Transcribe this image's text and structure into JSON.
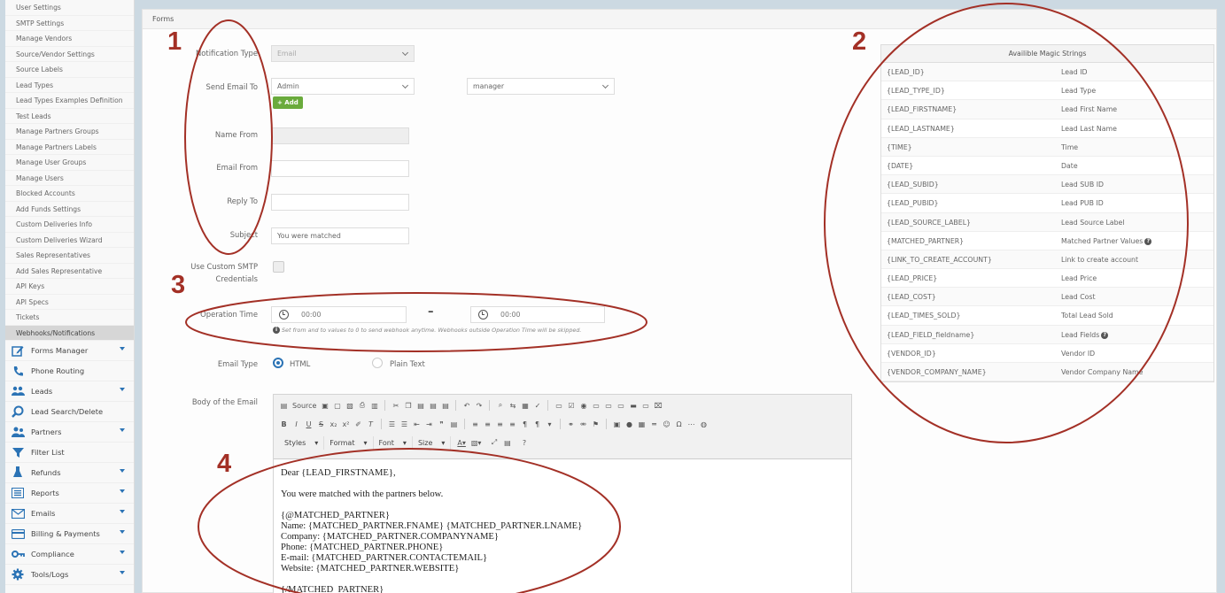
{
  "sidebar": {
    "plain_items": [
      {
        "label": "User Settings"
      },
      {
        "label": "SMTP Settings"
      },
      {
        "label": "Manage Vendors"
      },
      {
        "label": "Source/Vendor Settings"
      },
      {
        "label": "Source Labels"
      },
      {
        "label": "Lead Types"
      },
      {
        "label": "Lead Types Examples Definition"
      },
      {
        "label": "Test Leads"
      },
      {
        "label": "Manage Partners Groups"
      },
      {
        "label": "Manage Partners Labels"
      },
      {
        "label": "Manage User Groups"
      },
      {
        "label": "Manage Users"
      },
      {
        "label": "Blocked Accounts"
      },
      {
        "label": "Add Funds Settings"
      },
      {
        "label": "Custom Deliveries Info"
      },
      {
        "label": "Custom Deliveries Wizard"
      },
      {
        "label": "Sales Representatives"
      },
      {
        "label": "Add Sales Representative"
      },
      {
        "label": "API Keys"
      },
      {
        "label": "API Specs"
      },
      {
        "label": "Tickets"
      },
      {
        "label": "Webhooks/Notifications"
      }
    ],
    "active_index": 21,
    "menu_items": [
      {
        "label": "Forms Manager",
        "icon": "pencil-form-icon",
        "caret": true
      },
      {
        "label": "Phone Routing",
        "icon": "phone-icon",
        "caret": false
      },
      {
        "label": "Leads",
        "icon": "users-icon",
        "caret": true
      },
      {
        "label": "Lead Search/Delete",
        "icon": "search-icon",
        "caret": false
      },
      {
        "label": "Partners",
        "icon": "partners-icon",
        "caret": true
      },
      {
        "label": "Filter List",
        "icon": "filter-icon",
        "caret": false
      },
      {
        "label": "Refunds",
        "icon": "flask-icon",
        "caret": true
      },
      {
        "label": "Reports",
        "icon": "list-icon",
        "caret": true
      },
      {
        "label": "Emails",
        "icon": "envelope-icon",
        "caret": true
      },
      {
        "label": "Billing & Payments",
        "icon": "credit-card-icon",
        "caret": true
      },
      {
        "label": "Compliance",
        "icon": "key-icon",
        "caret": true
      },
      {
        "label": "Tools/Logs",
        "icon": "gear-icon",
        "caret": true
      }
    ],
    "accent_color": "#2b73b5"
  },
  "breadcrumb": "Forms",
  "form": {
    "notification_type": {
      "label": "Notification Type",
      "value": "Email"
    },
    "send_email_to": {
      "label": "Send Email To",
      "value": "Admin",
      "second_value": "manager",
      "add_label": "+ Add"
    },
    "name_from": {
      "label": "Name From",
      "value": ""
    },
    "email_from": {
      "label": "Email From",
      "value": ""
    },
    "reply_to": {
      "label": "Reply To",
      "value": ""
    },
    "subject": {
      "label": "Subject",
      "value": "You were matched"
    },
    "custom_smtp": {
      "label_line1": "Use Custom SMTP",
      "label_line2": "Credentials",
      "checked": false
    },
    "operation_time": {
      "label": "Operation Time",
      "from": "00:00",
      "to": "00:00",
      "dash": "–",
      "hint": "Set from and to values to 0 to send webhook anytime. Webhooks outside Operation Time will be skipped."
    },
    "email_type": {
      "label": "Email Type",
      "options": [
        "HTML",
        "Plain Text"
      ],
      "selected": "HTML"
    },
    "body": {
      "label": "Body of the Email",
      "toolbar": {
        "source_label": "Source",
        "styles_label": "Styles",
        "format_label": "Format",
        "font_label": "Font",
        "size_label": "Size",
        "help_label": "?"
      },
      "lines": [
        "Dear {LEAD_FIRSTNAME},",
        "",
        "You were matched with the partners below.",
        "",
        "{@MATCHED_PARTNER}",
        "Name: {MATCHED_PARTNER.FNAME} {MATCHED_PARTNER.LNAME}",
        "Company: {MATCHED_PARTNER.COMPANYNAME}",
        "Phone: {MATCHED_PARTNER.PHONE}",
        "E-mail: {MATCHED_PARTNER.CONTACTEMAIL}",
        "Website: {MATCHED_PARTNER.WEBSITE}",
        "",
        "{/MATCHED_PARTNER}"
      ]
    }
  },
  "magic_strings": {
    "title": "Availible Magic Strings",
    "rows": [
      {
        "key": "{LEAD_ID}",
        "value": "Lead ID",
        "help": false
      },
      {
        "key": "{LEAD_TYPE_ID}",
        "value": "Lead Type",
        "help": false
      },
      {
        "key": "{LEAD_FIRSTNAME}",
        "value": "Lead First Name",
        "help": false
      },
      {
        "key": "{LEAD_LASTNAME}",
        "value": "Lead Last Name",
        "help": false
      },
      {
        "key": "{TIME}",
        "value": "Time",
        "help": false
      },
      {
        "key": "{DATE}",
        "value": "Date",
        "help": false
      },
      {
        "key": "{LEAD_SUBID}",
        "value": "Lead SUB ID",
        "help": false
      },
      {
        "key": "{LEAD_PUBID}",
        "value": "Lead PUB ID",
        "help": false
      },
      {
        "key": "{LEAD_SOURCE_LABEL}",
        "value": "Lead Source Label",
        "help": false
      },
      {
        "key": "{MATCHED_PARTNER}",
        "value": "Matched Partner Values",
        "help": true
      },
      {
        "key": "{LINK_TO_CREATE_ACCOUNT}",
        "value": "Link to create account",
        "help": false
      },
      {
        "key": "{LEAD_PRICE}",
        "value": "Lead Price",
        "help": false
      },
      {
        "key": "{LEAD_COST}",
        "value": "Lead Cost",
        "help": false
      },
      {
        "key": "{LEAD_TIMES_SOLD}",
        "value": "Total Lead Sold",
        "help": false
      },
      {
        "key": "{LEAD_FIELD_fieldname}",
        "value": "Lead Fields",
        "help": true
      },
      {
        "key": "{VENDOR_ID}",
        "value": "Vendor ID",
        "help": false
      },
      {
        "key": "{VENDOR_COMPANY_NAME}",
        "value": "Vendor Company Name",
        "help": false
      }
    ]
  },
  "annotations": {
    "markers": [
      "1",
      "2",
      "3",
      "4"
    ],
    "color": "#a33026"
  }
}
